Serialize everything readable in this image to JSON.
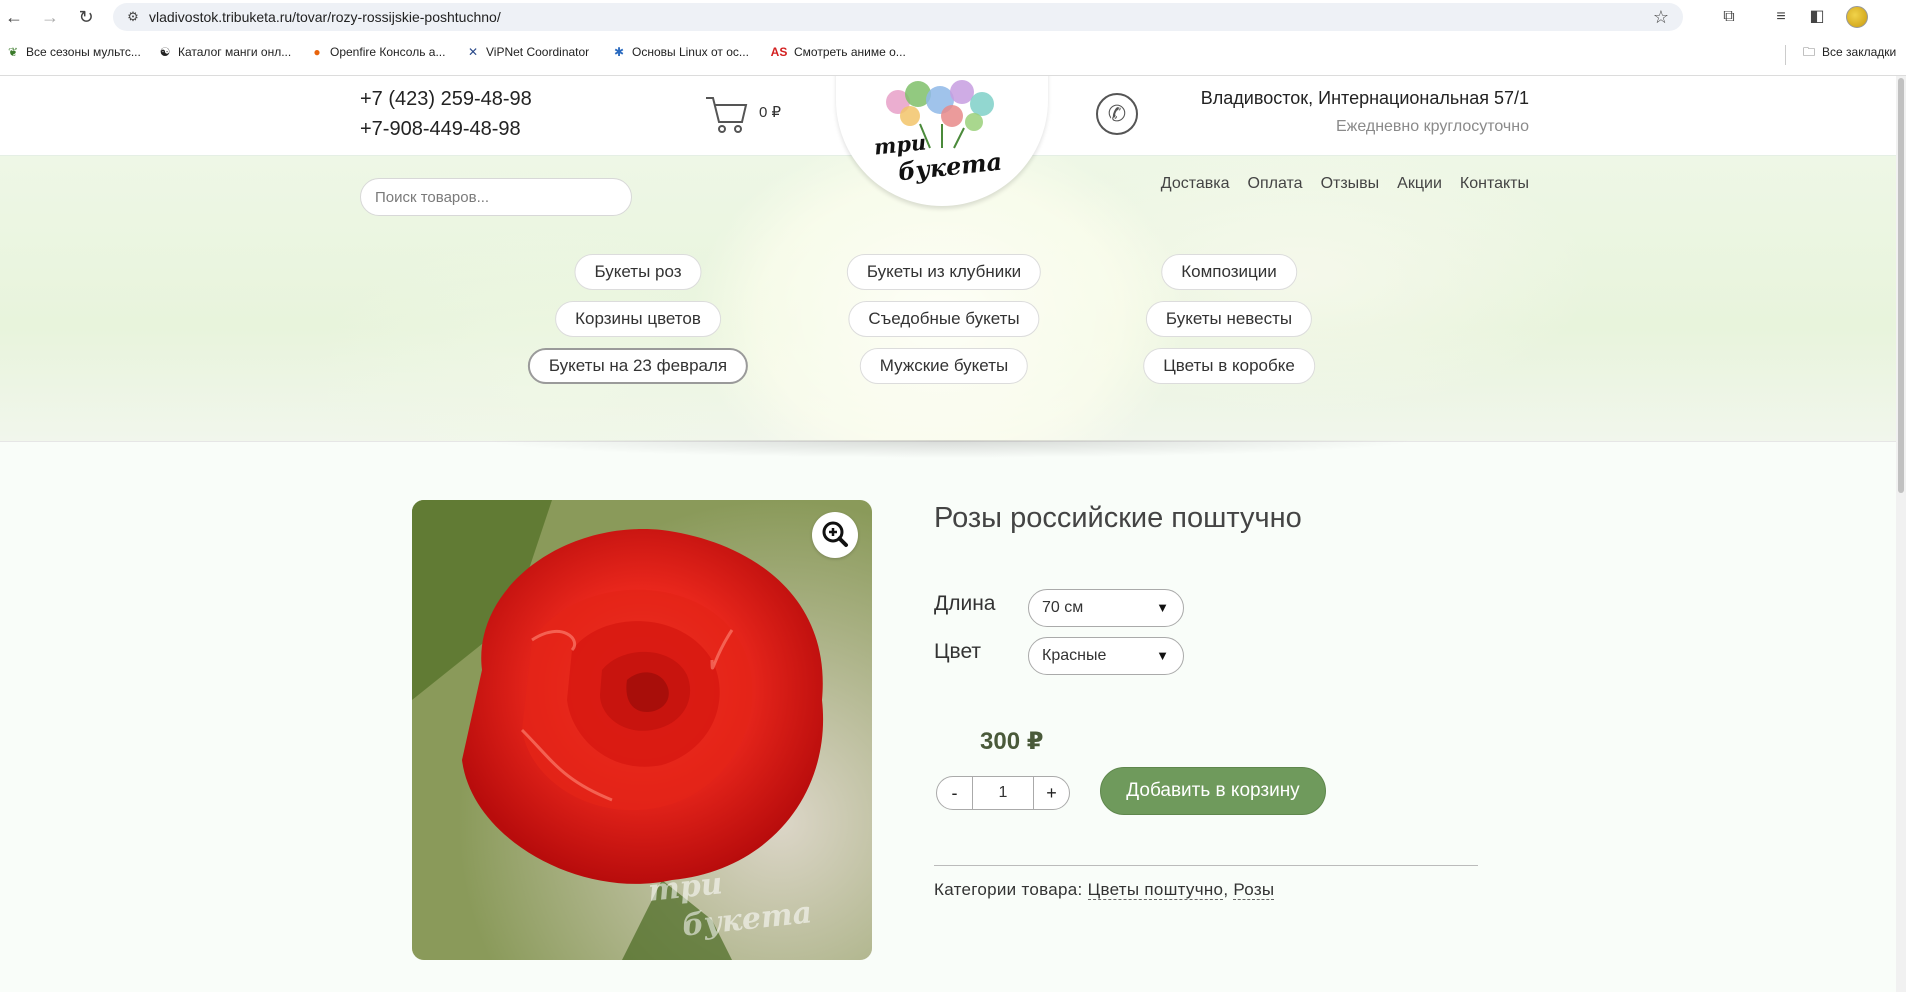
{
  "browser": {
    "url": "vladivostok.tribuketa.ru/tovar/rozy-rossijskie-poshtuchno/",
    "bookmarks": [
      "Все сезоны мультс...",
      "Каталог манги онл...",
      "Openfire Консоль а...",
      "ViPNet Coordinator",
      "Основы Linux от ос...",
      "Смотреть аниме о..."
    ],
    "all_bookmarks": "Все закладки"
  },
  "header": {
    "phone1": "+7 (423) 259-48-98",
    "phone2": "+7-908-449-48-98",
    "cart_sum": "0 ₽",
    "address": "Владивосток, Интернациональная 57/1",
    "hours": "Ежедневно круглосуточно",
    "logo_line1": "три",
    "logo_line2": "букета"
  },
  "search": {
    "placeholder": "Поиск товаров..."
  },
  "menu": [
    "Доставка",
    "Оплата",
    "Отзывы",
    "Акции",
    "Контакты"
  ],
  "categories": [
    "Букеты роз",
    "Букеты из клубники",
    "Композиции",
    "Корзины цветов",
    "Съедобные букеты",
    "Букеты невесты",
    "Букеты на 23 февраля",
    "Мужские букеты",
    "Цветы в коробке"
  ],
  "product": {
    "title": "Розы российские поштучно",
    "length_label": "Длина",
    "length_value": "70 см",
    "color_label": "Цвет",
    "color_value": "Красные",
    "price": "300 ₽",
    "qty_minus": "-",
    "qty_value": "1",
    "qty_plus": "+",
    "add_to_cart": "Добавить в корзину",
    "categories_label": "Категории товара:",
    "category_links": [
      "Цветы поштучно",
      "Розы"
    ],
    "watermark_line1": "три",
    "watermark_line2": "букета"
  }
}
